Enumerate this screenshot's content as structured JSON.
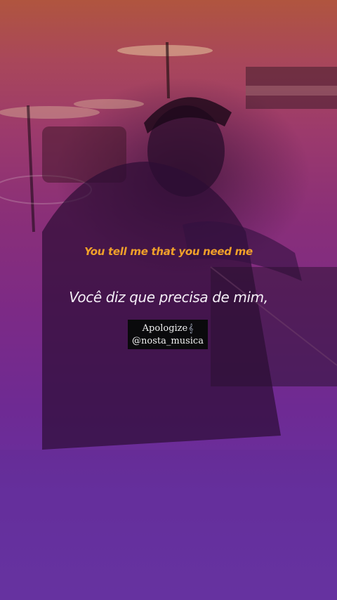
{
  "lyrics": {
    "original": "You tell me that you need me",
    "translation": "Você diz que precisa de mim,"
  },
  "watermark": {
    "song": "Apologize",
    "account": "@nosta_musica",
    "icon": "music-note-icon"
  },
  "colors": {
    "lyric_original": "#f0a02a",
    "lyric_translation": "#f4eef6",
    "gradient_top": "#b0553f",
    "gradient_bottom": "#6a35a6",
    "tag_background": "#0a0a0c"
  }
}
